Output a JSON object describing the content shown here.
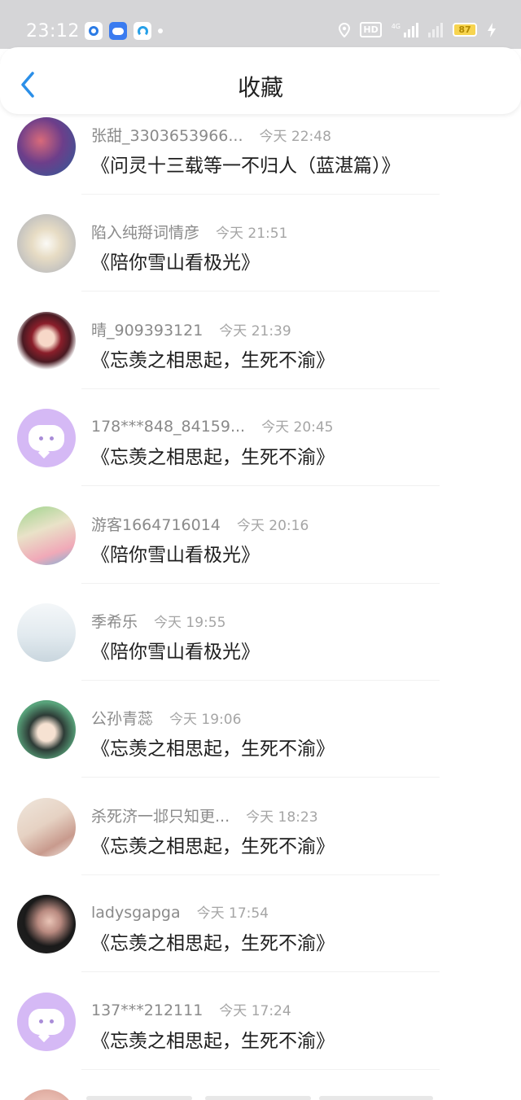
{
  "status_bar": {
    "time": "23:12",
    "hd_label": "HD",
    "network_label": "4G",
    "battery": "87"
  },
  "header": {
    "title": "收藏",
    "back_icon": "chevron-left-icon"
  },
  "colors": {
    "accent": "#2b8fe8",
    "default_avatar_bg": "#d5b9f5"
  },
  "favorites": [
    {
      "user": "张甜_3303653966...",
      "time": "今天 22:48",
      "title": "《问灵十三载等一不归人（蓝湛篇）》",
      "avatar": "photo"
    },
    {
      "user": "陷入纯搿词情彦",
      "time": "今天 21:51",
      "title": "《陪你雪山看极光》",
      "avatar": "photo"
    },
    {
      "user": "晴_909393121",
      "time": "今天 21:39",
      "title": "《忘羡之相思起，生死不渝》",
      "avatar": "photo"
    },
    {
      "user": "178***848_84159...",
      "time": "今天 20:45",
      "title": "《忘羡之相思起，生死不渝》",
      "avatar": "default"
    },
    {
      "user": "游客1664716014",
      "time": "今天 20:16",
      "title": "《陪你雪山看极光》",
      "avatar": "photo"
    },
    {
      "user": "季希乐",
      "time": "今天 19:55",
      "title": "《陪你雪山看极光》",
      "avatar": "photo"
    },
    {
      "user": "公孙青蕊",
      "time": "今天 19:06",
      "title": "《忘羡之相思起，生死不渝》",
      "avatar": "photo"
    },
    {
      "user": "杀死济一邶只知更...",
      "time": "今天 18:23",
      "title": "《忘羡之相思起，生死不渝》",
      "avatar": "photo"
    },
    {
      "user": "ladysgapga",
      "time": "今天 17:54",
      "title": "《忘羡之相思起，生死不渝》",
      "avatar": "photo"
    },
    {
      "user": "137***212111",
      "time": "今天 17:24",
      "title": "《忘羡之相思起，生死不渝》",
      "avatar": "default"
    }
  ]
}
